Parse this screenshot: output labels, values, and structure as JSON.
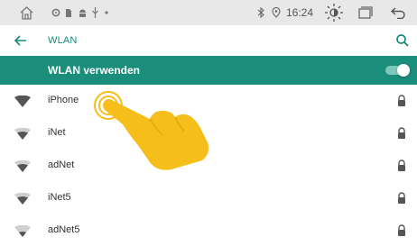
{
  "statusbar": {
    "time": "16:24",
    "icons": [
      "home-icon",
      "settings-icon",
      "sim-icon",
      "android-icon",
      "usb-icon",
      "dot-icon",
      "bluetooth-icon",
      "location-icon",
      "brightness-icon",
      "recent-apps-icon",
      "back-icon"
    ]
  },
  "appbar": {
    "title": "WLAN"
  },
  "wlan_switch": {
    "label": "WLAN verwenden",
    "enabled": true
  },
  "networks": [
    {
      "name": "iPhone",
      "secured": true
    },
    {
      "name": "iNet",
      "secured": true
    },
    {
      "name": "adNet",
      "secured": true
    },
    {
      "name": "iNet5",
      "secured": true
    },
    {
      "name": "adNet5",
      "secured": true
    }
  ],
  "colors": {
    "accent": "#1b8d7b",
    "title": "#1a8a7a",
    "hand": "#f6be1a"
  }
}
